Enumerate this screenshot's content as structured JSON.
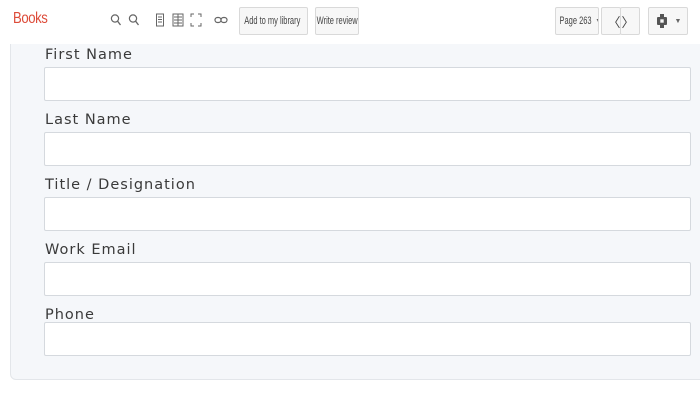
{
  "app": {
    "brand": "Books"
  },
  "toolbar": {
    "icons": [
      "zoom-out-icon",
      "zoom-in-icon",
      "single-page-icon",
      "two-page-icon",
      "fullscreen-icon",
      "link-icon",
      "settings-gear-icon"
    ],
    "add_to_library_label": "Add to my library",
    "write_review_label": "Write review",
    "page_label": "Page 263",
    "prev_glyph": "〈",
    "next_glyph": "〉"
  },
  "form": {
    "fields": [
      {
        "label": "First Name",
        "value": "",
        "placeholder": ""
      },
      {
        "label": "Last Name",
        "value": "",
        "placeholder": ""
      },
      {
        "label": "Title / Designation",
        "value": "",
        "placeholder": ""
      },
      {
        "label": "Work Email",
        "value": "",
        "placeholder": ""
      },
      {
        "label": "Phone",
        "value": "",
        "placeholder": ""
      }
    ]
  },
  "colors": {
    "brand": "#dd4b39",
    "panel_bg": "#f5f7fa",
    "field_border": "#d5d9de"
  }
}
